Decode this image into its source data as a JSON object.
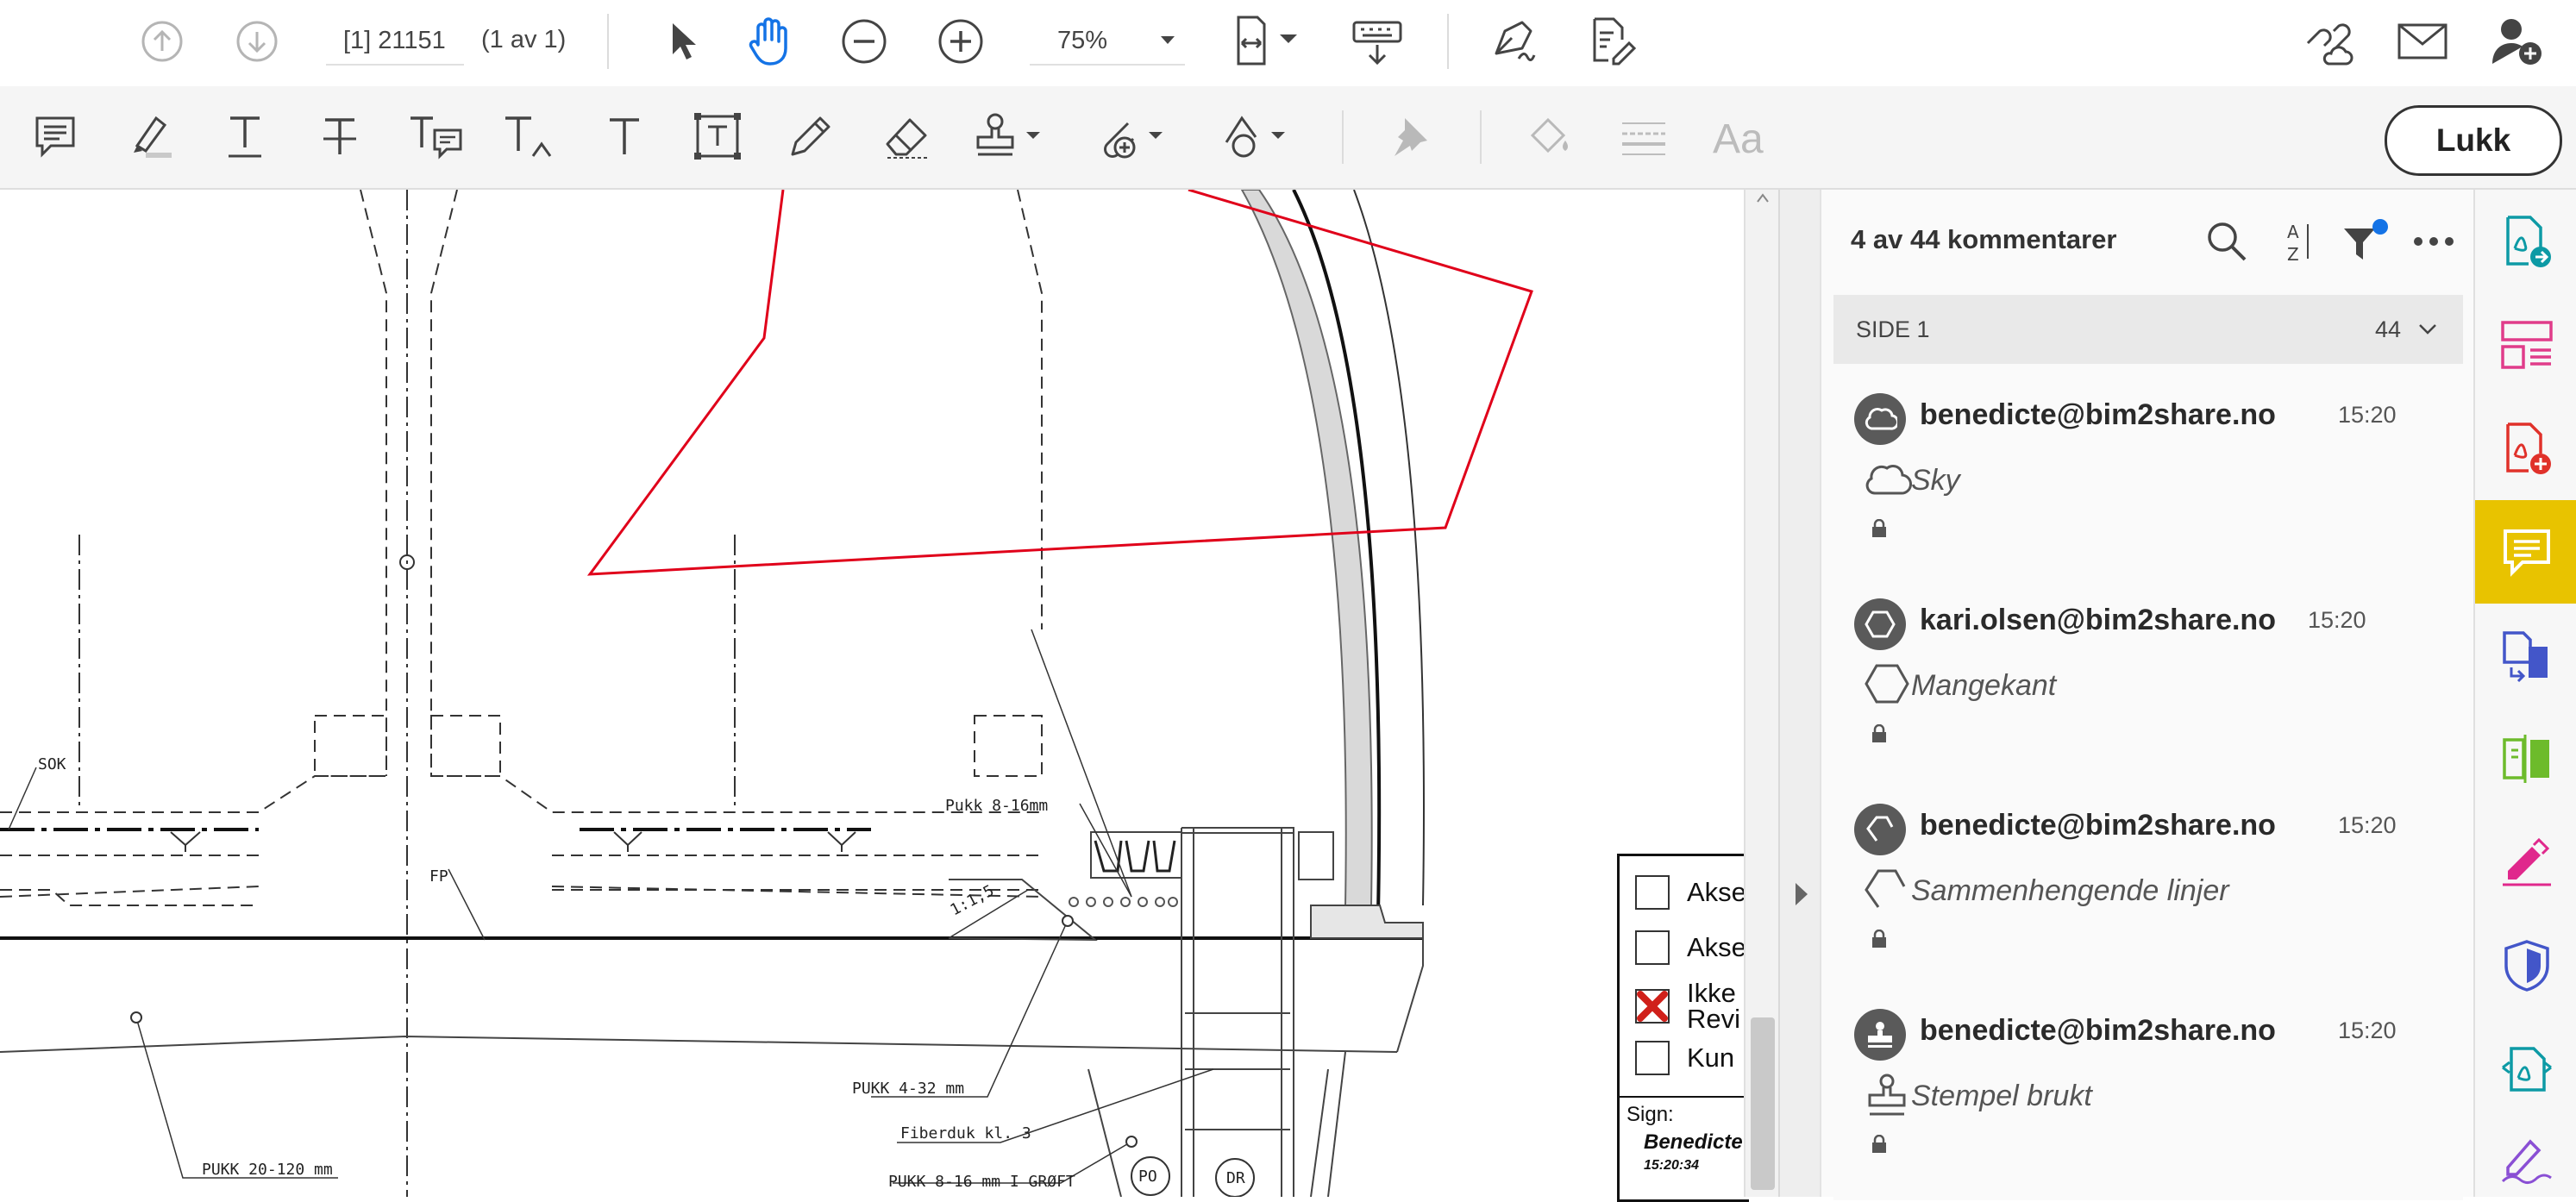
{
  "top_toolbar": {
    "page_field": "[1] 21151",
    "page_count": "(1 av 1)",
    "zoom": "75%"
  },
  "comment_toolbar": {
    "close_label": "Lukk",
    "font_label": "Aa"
  },
  "panel": {
    "header": "4 av 44 kommentarer",
    "section_label": "SIDE 1",
    "section_count": "44",
    "comments": [
      {
        "author": "benedicte@bim2share.no",
        "time": "15:20",
        "type": "Sky",
        "type_icon": "cloud-icon",
        "avatar_icon": "cloud-icon"
      },
      {
        "author": "kari.olsen@bim2share.no",
        "time": "15:20",
        "type": "Mangekant",
        "type_icon": "polygon-icon",
        "avatar_icon": "polygon-icon"
      },
      {
        "author": "benedicte@bim2share.no",
        "time": "15:20",
        "type": "Sammenhengende linjer",
        "type_icon": "polyline-icon",
        "avatar_icon": "polyline-icon"
      },
      {
        "author": "benedicte@bim2share.no",
        "time": "15:20",
        "type": "Stempel brukt",
        "type_icon": "stamp-icon",
        "avatar_icon": "stamp-icon"
      }
    ]
  },
  "drawing": {
    "labels": {
      "sok": "SOK",
      "fp": "FP",
      "pukk_8_16": "Pukk 8-16mm",
      "slope": "1:1,5",
      "pukk_4_32": "PUKK 4-32 mm",
      "fiberduk": "Fiberduk kl. 3",
      "pukk_8_16_grøft": "PUKK 8-16 mm I GRØFT",
      "pukk_20_120": "PUKK 20-120 mm",
      "po": "PO",
      "dr": "DR"
    },
    "stamp": {
      "rows": [
        {
          "label": "Akse",
          "checked": false
        },
        {
          "label": "Akse",
          "checked": false
        },
        {
          "label": "Ikke Revi",
          "checked": true
        },
        {
          "label": "Kun",
          "checked": false
        }
      ],
      "sign_label": "Sign:",
      "signer": "Benedicte",
      "sign_time": "15:20:34"
    }
  },
  "colors": {
    "accent_red": "#e0001a",
    "active_rail": "#e8c300",
    "filter_dot": "#1473e6"
  }
}
